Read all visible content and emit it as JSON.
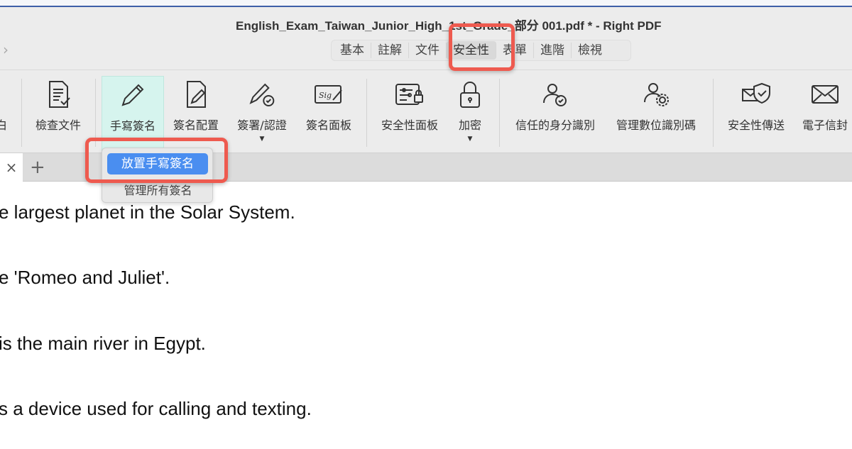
{
  "window": {
    "title": "English_Exam_Taiwan_Junior_High_1st_Grade_部分 001.pdf * - Right PDF"
  },
  "ribbon_tabs": [
    {
      "label": "基本",
      "selected": false
    },
    {
      "label": "註解",
      "selected": false
    },
    {
      "label": "文件",
      "selected": false
    },
    {
      "label": "安全性",
      "selected": true
    },
    {
      "label": "表單",
      "selected": false
    },
    {
      "label": "進階",
      "selected": false
    },
    {
      "label": "檢視",
      "selected": false
    }
  ],
  "toolbar": {
    "partial_label": "白",
    "items": [
      {
        "label": "檢查文件",
        "icon": "document-check-icon"
      },
      {
        "label": "手寫簽名",
        "icon": "pen-icon",
        "active": true
      },
      {
        "label": "簽名配置",
        "icon": "document-pen-icon"
      },
      {
        "label": "簽署/認證",
        "icon": "pen-check-icon",
        "dropdown": true
      },
      {
        "label": "簽名面板",
        "icon": "signature-panel-icon"
      },
      {
        "label": "安全性面板",
        "icon": "security-panel-icon"
      },
      {
        "label": "加密",
        "icon": "lock-icon",
        "dropdown": true
      },
      {
        "label": "信任的身分識別",
        "icon": "user-check-icon"
      },
      {
        "label": "管理數位識別碼",
        "icon": "user-gear-icon"
      },
      {
        "label": "安全性傳送",
        "icon": "mail-shield-icon"
      },
      {
        "label": "電子信封",
        "icon": "envelope-icon"
      }
    ]
  },
  "dropdown_menu": {
    "items": [
      {
        "label": "放置手寫簽名",
        "highlighted": true
      },
      {
        "label": "管理所有簽名",
        "highlighted": false
      }
    ]
  },
  "document": {
    "lines": [
      "e largest planet in the Solar System.",
      "e 'Romeo and Juliet'.",
      "is the main river in Egypt.",
      "s a device used for calling and texting."
    ]
  },
  "colors": {
    "highlight_box": "#ee5a4f",
    "menu_selected": "#4a8ef0",
    "active_tool": "#d6f4ee"
  }
}
